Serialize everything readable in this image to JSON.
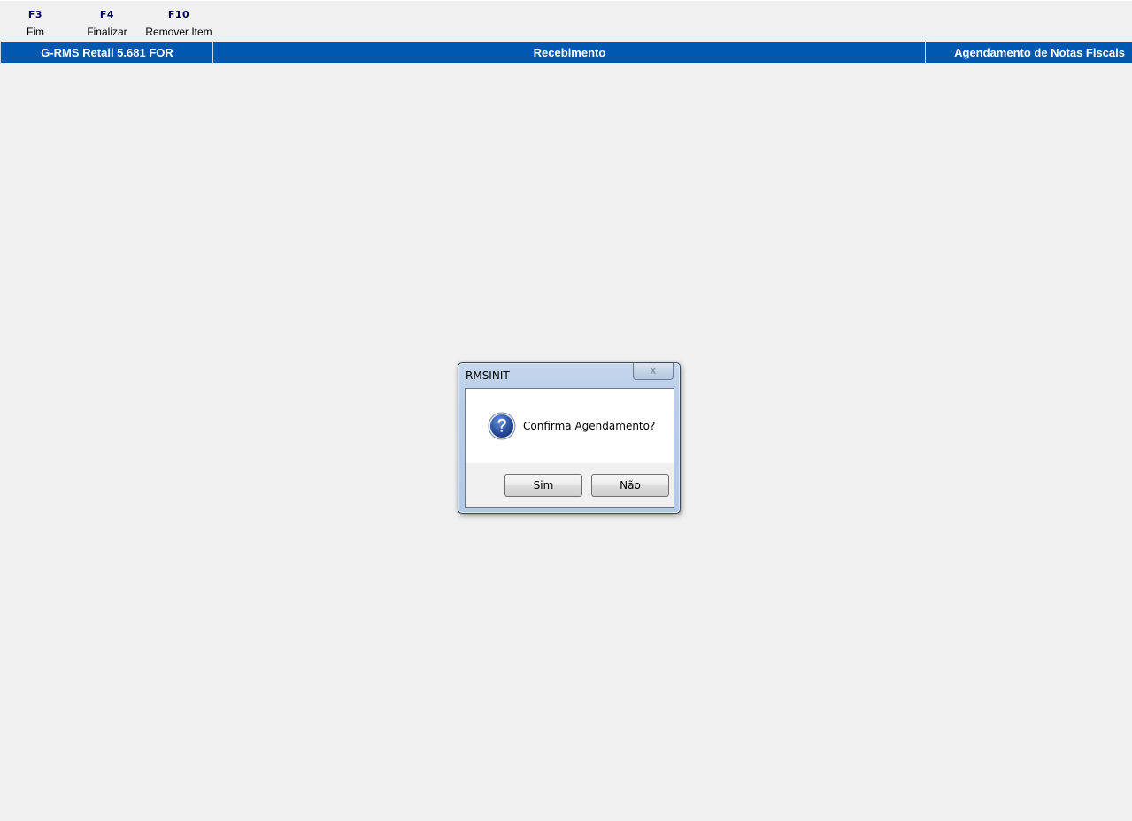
{
  "function_keys": [
    {
      "key": "F3",
      "label": "Fim"
    },
    {
      "key": "F4",
      "label": "Finalizar"
    },
    {
      "key": "F10",
      "label": "Remover Item"
    }
  ],
  "header": {
    "app": "G-RMS Retail 5.681 FOR",
    "module": "Recebimento",
    "screen": "Agendamento de Notas Fiscais",
    "color": "#0058b0"
  },
  "dialog": {
    "title": "RMSINIT",
    "close_label": "x",
    "icon": "question-icon",
    "message": "Confirma Agendamento?",
    "yes_label": "Sim",
    "no_label": "Não"
  }
}
